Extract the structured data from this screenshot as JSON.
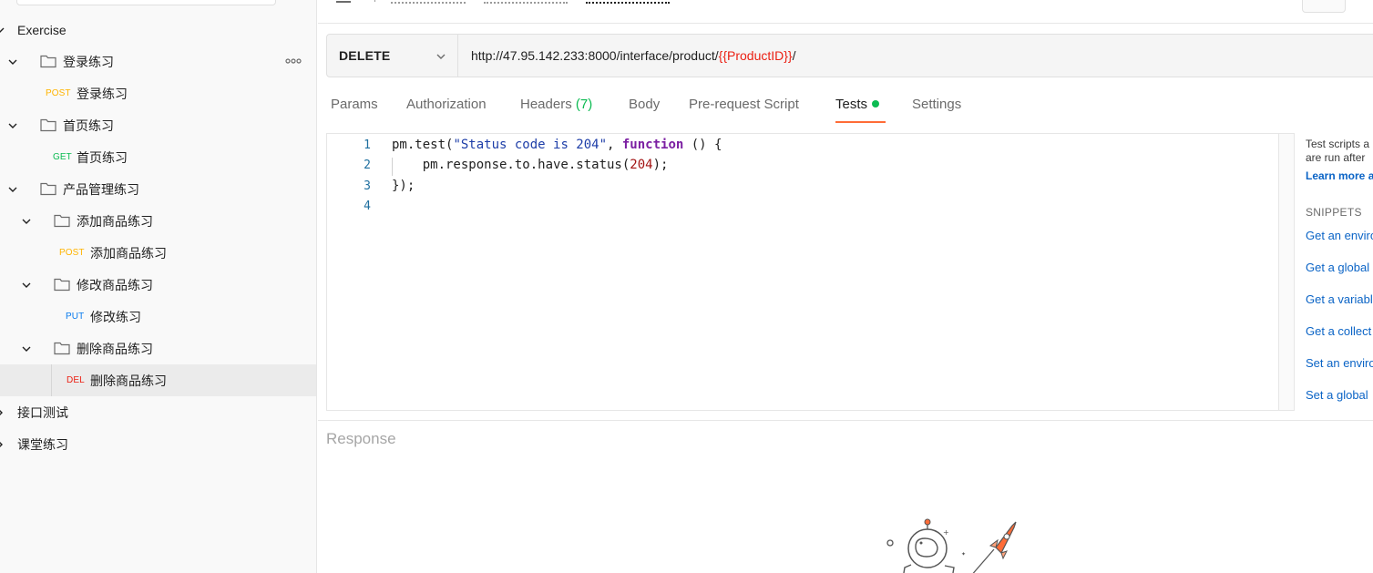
{
  "sidebar": {
    "items": [
      {
        "kind": "folder-root",
        "label": "Exercise"
      },
      {
        "kind": "folder",
        "label": "登录练习"
      },
      {
        "kind": "request",
        "method": "POST",
        "label": "登录练习"
      },
      {
        "kind": "folder",
        "label": "首页练习"
      },
      {
        "kind": "request",
        "method": "GET",
        "label": "首页练习"
      },
      {
        "kind": "folder",
        "label": "产品管理练习"
      },
      {
        "kind": "folder",
        "label": "添加商品练习"
      },
      {
        "kind": "request",
        "method": "POST",
        "label": "添加商品练习"
      },
      {
        "kind": "folder",
        "label": "修改商品练习"
      },
      {
        "kind": "request",
        "method": "PUT",
        "label": "修改练习"
      },
      {
        "kind": "folder",
        "label": "删除商品练习"
      },
      {
        "kind": "request",
        "method": "DEL",
        "label": "删除商品练习",
        "selected": true
      },
      {
        "kind": "folder-root",
        "label": "接口测试"
      },
      {
        "kind": "folder-root",
        "label": "课堂练习"
      }
    ]
  },
  "request": {
    "method": "DELETE",
    "url_prefix": "http://47.95.142.233:8000/interface/product/",
    "url_variable": "{{ProductID}}",
    "url_suffix": "/"
  },
  "tabs": {
    "params": "Params",
    "authorization": "Authorization",
    "headers": "Headers",
    "headers_count": "(7)",
    "body": "Body",
    "prerequest": "Pre-request Script",
    "tests": "Tests",
    "settings": "Settings",
    "active": "Tests"
  },
  "editor": {
    "line_numbers": [
      "1",
      "2",
      "3",
      "4"
    ],
    "line1": {
      "a": "pm.test(",
      "b": "\"Status code is 204\"",
      "c": ", ",
      "d": "function",
      "e": " () {"
    },
    "line2": {
      "a": "    pm.response.to.have.status(",
      "b": "204",
      "c": ");"
    },
    "line3": "});"
  },
  "snippets_panel": {
    "desc_line1": "Test scripts a",
    "desc_line2": "are run after",
    "learn_more": "Learn more a",
    "heading": "SNIPPETS",
    "links": [
      "Get an enviro",
      "Get a global",
      "Get a variabl",
      "Get a collect",
      "Set an enviro",
      "Set a global"
    ]
  },
  "response": {
    "title": "Response"
  },
  "colors": {
    "accent": "#ff6c37",
    "post": "#ffb400",
    "get": "#0cbb52",
    "put": "#097bed",
    "del": "#eb2013",
    "link": "#0b64c6"
  }
}
